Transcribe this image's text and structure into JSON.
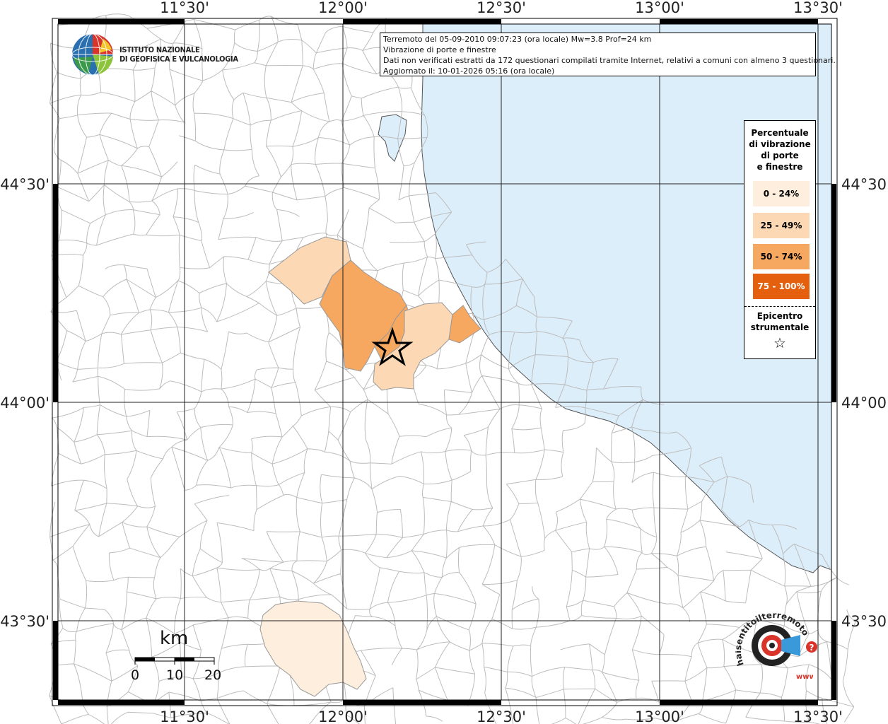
{
  "info": {
    "line1": "Terremoto del 05-09-2010 09:07:23 (ora locale) Mw=3.8 Prof=24 km",
    "line2": "Vibrazione di porte e finestre",
    "line3": "Dati non verificati estratti da 172 questionari compilati tramite Internet, relativi a comuni con almeno 3 questionari.",
    "line4": "Aggiornato il: 10-01-2026 05:16 (ora locale)"
  },
  "logo": {
    "line1": "ISTITUTO NAZIONALE",
    "line2": "DI GEOFISICA E VULCANOLOGIA"
  },
  "axes": {
    "longitudes": [
      "11°30'",
      "12°00'",
      "12°30'",
      "13°00'",
      "13°30'"
    ],
    "latitudes": [
      "44°30'",
      "44°00'",
      "43°30'"
    ]
  },
  "legend": {
    "title_lines": [
      "Percentuale",
      "di vibrazione",
      "di porte",
      "e finestre"
    ],
    "classes": [
      {
        "label": "0 - 24%",
        "color": "#fdeedd"
      },
      {
        "label": "25 - 49%",
        "color": "#fcd8b5"
      },
      {
        "label": "50 - 74%",
        "color": "#f6a760"
      },
      {
        "label": "75 - 100%",
        "color": "#e5600e"
      }
    ],
    "epicenter_lines": [
      "Epicentro",
      "strumentale"
    ],
    "star": "☆"
  },
  "scale": {
    "unit": "km",
    "ticks": [
      "0",
      "10",
      "20"
    ]
  },
  "colors": {
    "sea": "#ddeefb",
    "border": "#b3b3b3"
  },
  "badge": {
    "text": "haisentitoilterremoto.it",
    "url": "www"
  }
}
